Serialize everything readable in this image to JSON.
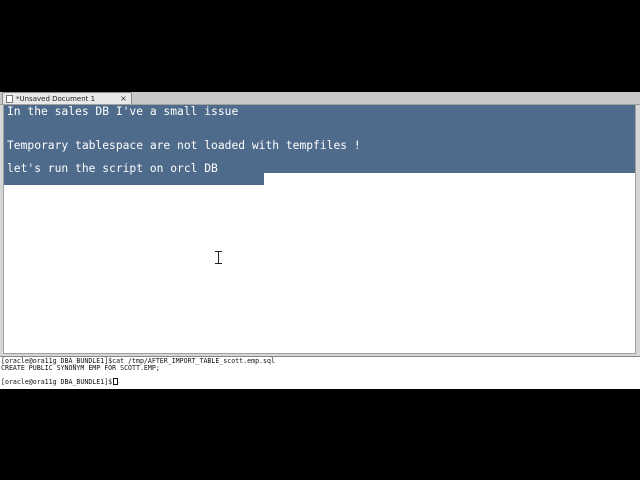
{
  "gedit": {
    "tab": {
      "title": "*Unsaved Document 1",
      "close": "×"
    },
    "lines": [
      "In the sales DB I've a small issue",
      "",
      "Temporary tablespace are not loaded with tempfiles !",
      "",
      "let's run the script on orcl DB"
    ],
    "selection_color": "#4e6b8c"
  },
  "terminal": {
    "lines": [
      "[oracle@ora11g DBA_BUNDLE1]$cat /tmp/AFTER_IMPORT_TABLE_scott.emp.sql",
      "CREATE PUBLIC SYNONYM EMP FOR SCOTT.EMP;",
      "",
      "[oracle@ora11g DBA_BUNDLE1]$"
    ]
  }
}
